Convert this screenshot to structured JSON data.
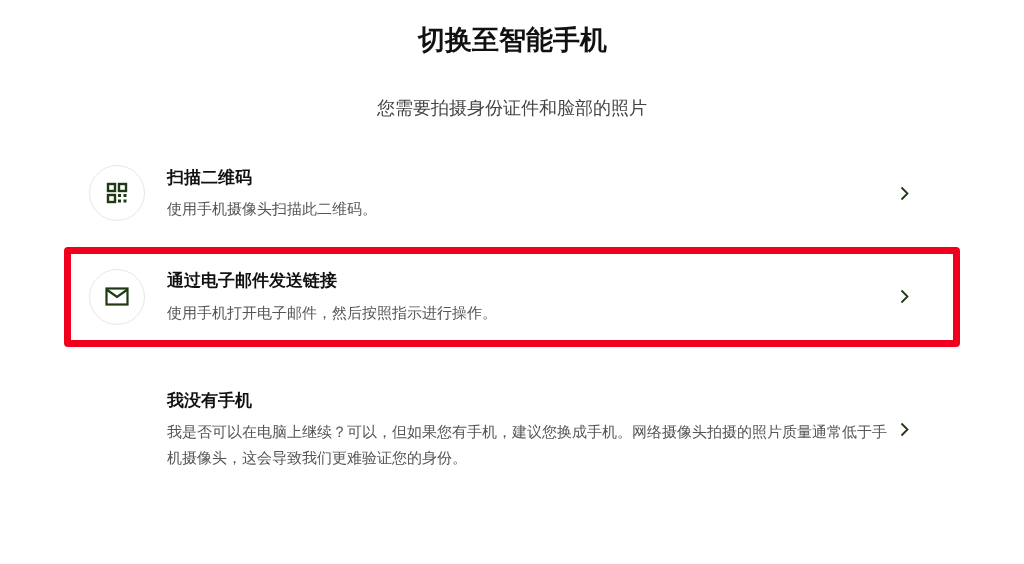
{
  "title": "切换至智能手机",
  "subtitle": "您需要拍摄身份证件和脸部的照片",
  "options": [
    {
      "kind": "qr",
      "title": "扫描二维码",
      "description": "使用手机摄像头扫描此二维码。",
      "highlighted": false
    },
    {
      "kind": "email",
      "title": "通过电子邮件发送链接",
      "description": "使用手机打开电子邮件，然后按照指示进行操作。",
      "highlighted": true
    },
    {
      "kind": "none",
      "title": "我没有手机",
      "description": "我是否可以在电脑上继续？可以，但如果您有手机，建议您换成手机。网络摄像头拍摄的照片质量通常低于手机摄像头，这会导致我们更难验证您的身份。",
      "highlighted": false
    }
  ]
}
